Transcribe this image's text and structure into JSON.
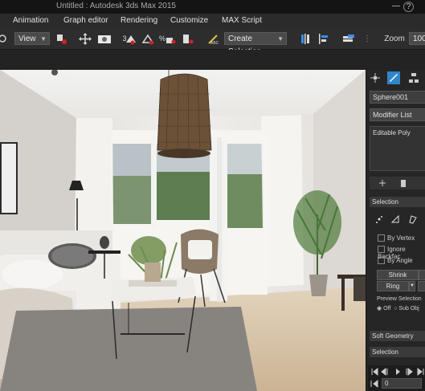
{
  "titlebar": {
    "title": "Untitled : Autodesk 3ds Max 2015",
    "help": "?"
  },
  "menu": {
    "items": [
      "Animation",
      "Graph editor",
      "Rendering",
      "Customize",
      "MAX Script"
    ]
  },
  "toolbar": {
    "view_dropdown": "View",
    "selection_dropdown": "Create Selection...",
    "zoom_label": "Zoom :",
    "zoom_value": "100",
    "snap_labels": [
      "3",
      "%"
    ]
  },
  "panel": {
    "object_name": "Sphere001",
    "modifier_list": "Modifier List",
    "modifier_stack_item": "Editable Poly",
    "selection_header": "Selection",
    "checkboxes": [
      "By Vertex",
      "Ignore Backfac",
      "By Angle"
    ],
    "shrink": "Shrink",
    "ring": "Ring",
    "preview_selection": "Preview Selection",
    "preview_options": [
      "Off",
      "Sub Obj"
    ],
    "soft_selection_header": "Soft Geometry",
    "selection_header_2": "Selection",
    "frame_value": "0"
  },
  "colors": {
    "accent": "#3a8ee6",
    "active_tab": "#2f87c8",
    "highlight_red": "#d42020"
  }
}
